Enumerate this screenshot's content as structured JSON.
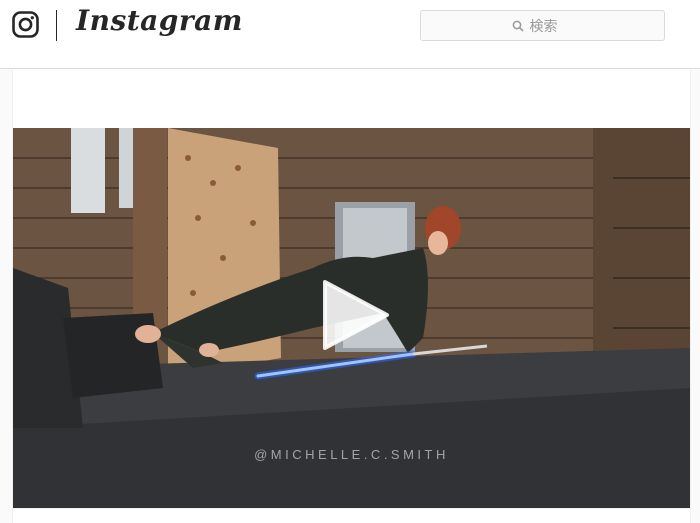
{
  "header": {
    "logo_icon": "instagram-glyph-icon",
    "wordmark": "Instagram",
    "search": {
      "placeholder": "検索",
      "icon": "search-icon"
    }
  },
  "post": {
    "media_type": "video",
    "play_icon": "play-icon",
    "watermark": "@MICHELLE.C.SMITH"
  },
  "colors": {
    "border": "#dbdbdb",
    "text": "#262626",
    "placeholder": "#999999",
    "lightsaber": "#2f6bff"
  }
}
